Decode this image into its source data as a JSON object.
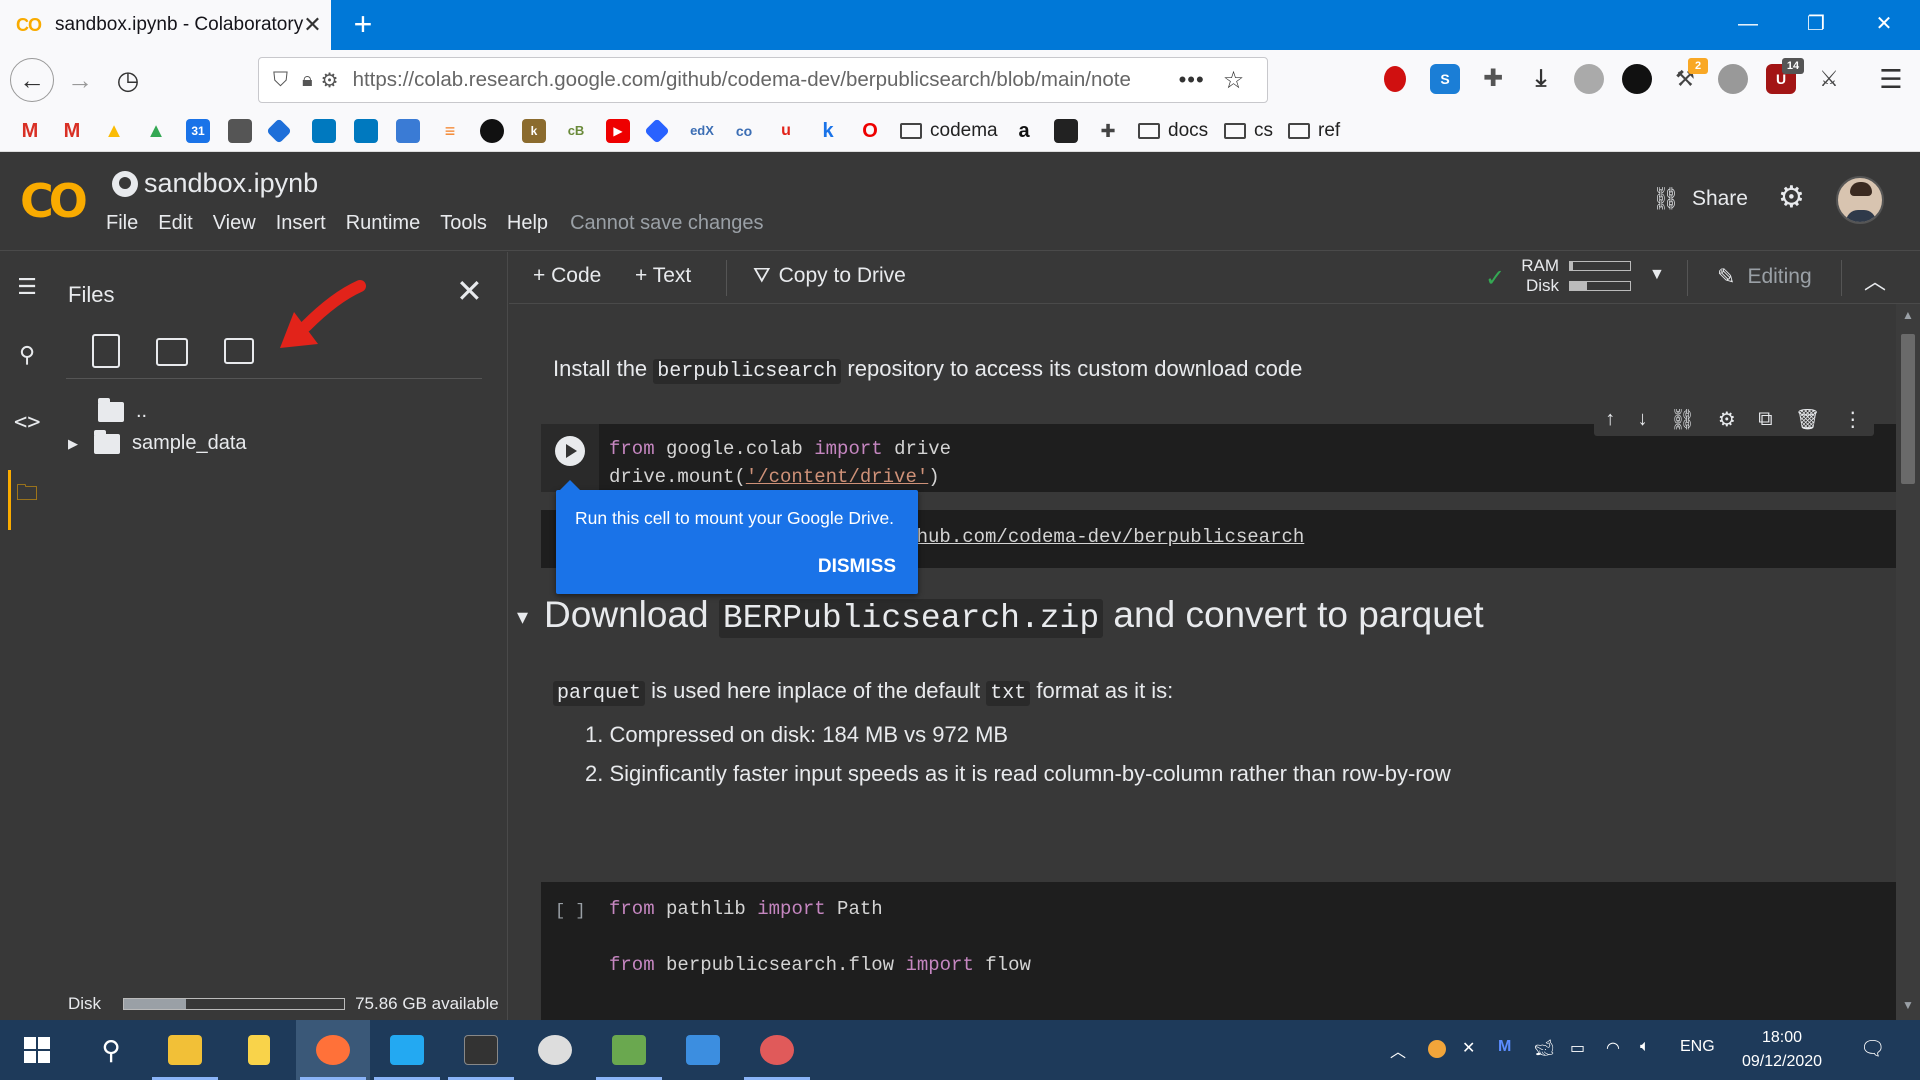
{
  "browser": {
    "tab_title": "sandbox.ipynb - Colaboratory",
    "tab_logo": "CO",
    "new_tab_symbol": "+",
    "url": "https://colab.research.google.com/github/codema-dev/berpublicsearch/blob/main/note",
    "extension_badges": {
      "hammer_badge": "2",
      "ublock_badge": "14"
    },
    "bookmarks": {
      "folder_codema": "codema",
      "folder_docs": "docs",
      "folder_cs": "cs",
      "folder_ref": "ref"
    }
  },
  "colab": {
    "logo": "CO",
    "notebook_title": "sandbox.ipynb",
    "menu": [
      "File",
      "Edit",
      "View",
      "Insert",
      "Runtime",
      "Tools",
      "Help"
    ],
    "save_status": "Cannot save changes",
    "share_label": "Share"
  },
  "files_panel": {
    "title": "Files",
    "parent_label": "..",
    "folder_label": "sample_data",
    "disk_label": "Disk",
    "disk_available": "75.86 GB available",
    "disk_usage_fraction": 0.28
  },
  "toolbar": {
    "code_label": "+ Code",
    "text_label": "+ Text",
    "copy_label": "Copy to Drive",
    "ram_label": "RAM",
    "disk_label": "Disk",
    "ram_usage_fraction": 0.05,
    "disk_usage_fraction": 0.28,
    "editing_label": "Editing"
  },
  "notebook": {
    "intro_pre": "Install the ",
    "intro_code": "berpublicsearch",
    "intro_post": " repository to access its custom download code",
    "cell1": {
      "l1_kw1": "from",
      "l1_mod": " google.colab ",
      "l1_kw2": "import",
      "l1_name": " drive",
      "l2_pre": "drive.mount(",
      "l2_str": "'/content/drive'",
      "l2_post": ")"
    },
    "cell2_text": "/github.com/codema-dev/berpublicsearch",
    "heading_pre": "Download ",
    "heading_code": "BERPublicsearch.zip",
    "heading_post": " and convert to parquet",
    "para_code1": "parquet",
    "para_mid": " is used here inplace of the default ",
    "para_code2": "txt",
    "para_post": " format as it is:",
    "list": [
      "Compressed on disk: 184 MB vs 972 MB",
      "Siginficantly faster input speeds as it is read column-by-column rather than row-by-row"
    ],
    "cell3": {
      "bracket": "[ ]",
      "l1_kw1": "from",
      "l1_mod": " pathlib ",
      "l1_kw2": "import",
      "l1_name": " Path",
      "l3_kw1": "from",
      "l3_mod": " berpublicsearch.flow ",
      "l3_kw2": "import",
      "l3_name": " flow"
    }
  },
  "tooltip": {
    "message": "Run this cell to mount your Google Drive.",
    "dismiss_label": "DISMISS"
  },
  "taskbar": {
    "language": "ENG",
    "time": "18:00",
    "date": "09/12/2020"
  },
  "colors": {
    "accent_orange": "#f9ab00",
    "tooltip_blue": "#1a73e8",
    "annotation_red": "#e2231a"
  }
}
